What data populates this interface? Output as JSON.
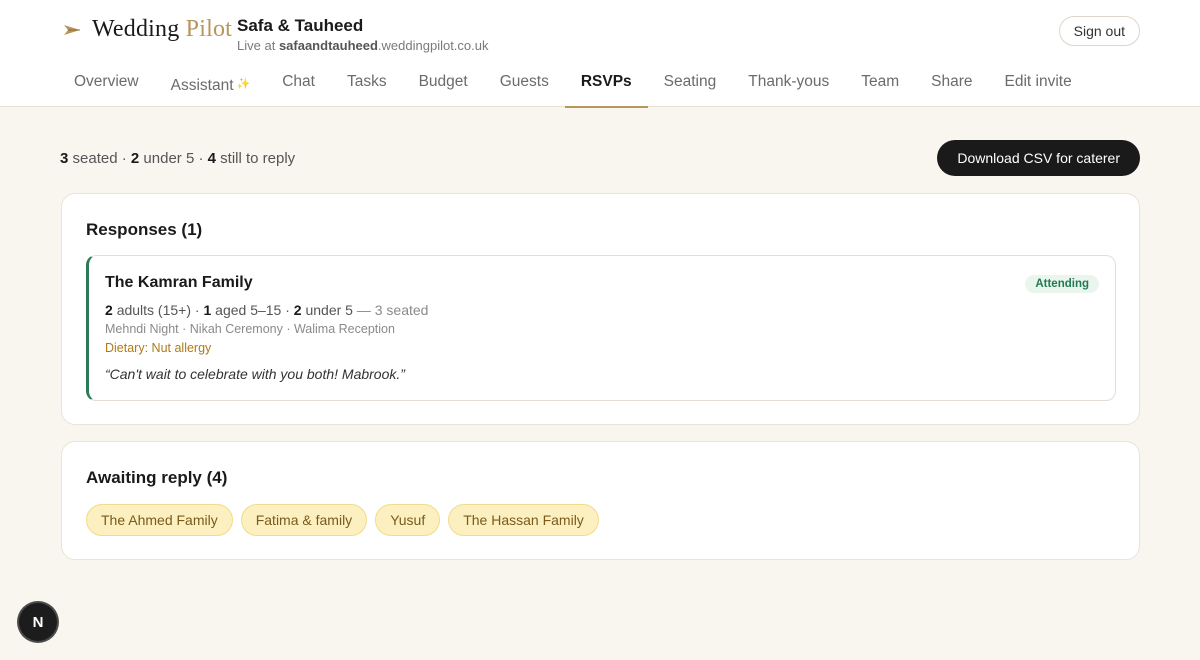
{
  "brand": {
    "name_main": "Wedding",
    "name_accent": "Pilot"
  },
  "couple": {
    "name": "Safa & Tauheed",
    "live_prefix": "Live at",
    "subdomain": "safaandtauheed",
    "domain": ".weddingpilot.co.uk"
  },
  "header": {
    "signout_label": "Sign out"
  },
  "nav": {
    "items": [
      {
        "label": "Overview"
      },
      {
        "label": "Assistant"
      },
      {
        "label": "Chat"
      },
      {
        "label": "Tasks"
      },
      {
        "label": "Budget"
      },
      {
        "label": "Guests"
      },
      {
        "label": "RSVPs"
      },
      {
        "label": "Seating"
      },
      {
        "label": "Thank-yous"
      },
      {
        "label": "Team"
      },
      {
        "label": "Share"
      },
      {
        "label": "Edit invite"
      }
    ],
    "active": "RSVPs",
    "assistant_sparkle": "✨"
  },
  "summary": {
    "seated": "3",
    "seated_label": "seated",
    "under5": "2",
    "under5_label": "under 5",
    "to_reply": "4",
    "to_reply_label": "still to reply",
    "sep": "·"
  },
  "actions": {
    "csv_label": "Download CSV for caterer"
  },
  "responses": {
    "title": "Responses (1)",
    "items": [
      {
        "name": "The Kamran Family",
        "status": "Attending",
        "adults": "2",
        "adults_label": "adults (15+)",
        "aged": "1",
        "aged_label": "aged 5–15",
        "under5": "2",
        "under5_label": "under 5",
        "seated_text": "— 3 seated",
        "events": "Mehndi Night · Nikah Ceremony · Walima Reception",
        "dietary": "Dietary: Nut allergy",
        "note": "“Can't wait to celebrate with you both! Mabrook.”"
      }
    ]
  },
  "awaiting": {
    "title": "Awaiting reply (4)",
    "items": [
      "The Ahmed Family",
      "Fatima & family",
      "Yusuf",
      "The Hassan Family"
    ]
  },
  "dev_badge": {
    "letter": "N"
  },
  "colors": {
    "accent": "#b8955a",
    "attending": "#2d7a5a",
    "chip_bg": "#fcf0c0",
    "dark": "#1a1a1a"
  }
}
